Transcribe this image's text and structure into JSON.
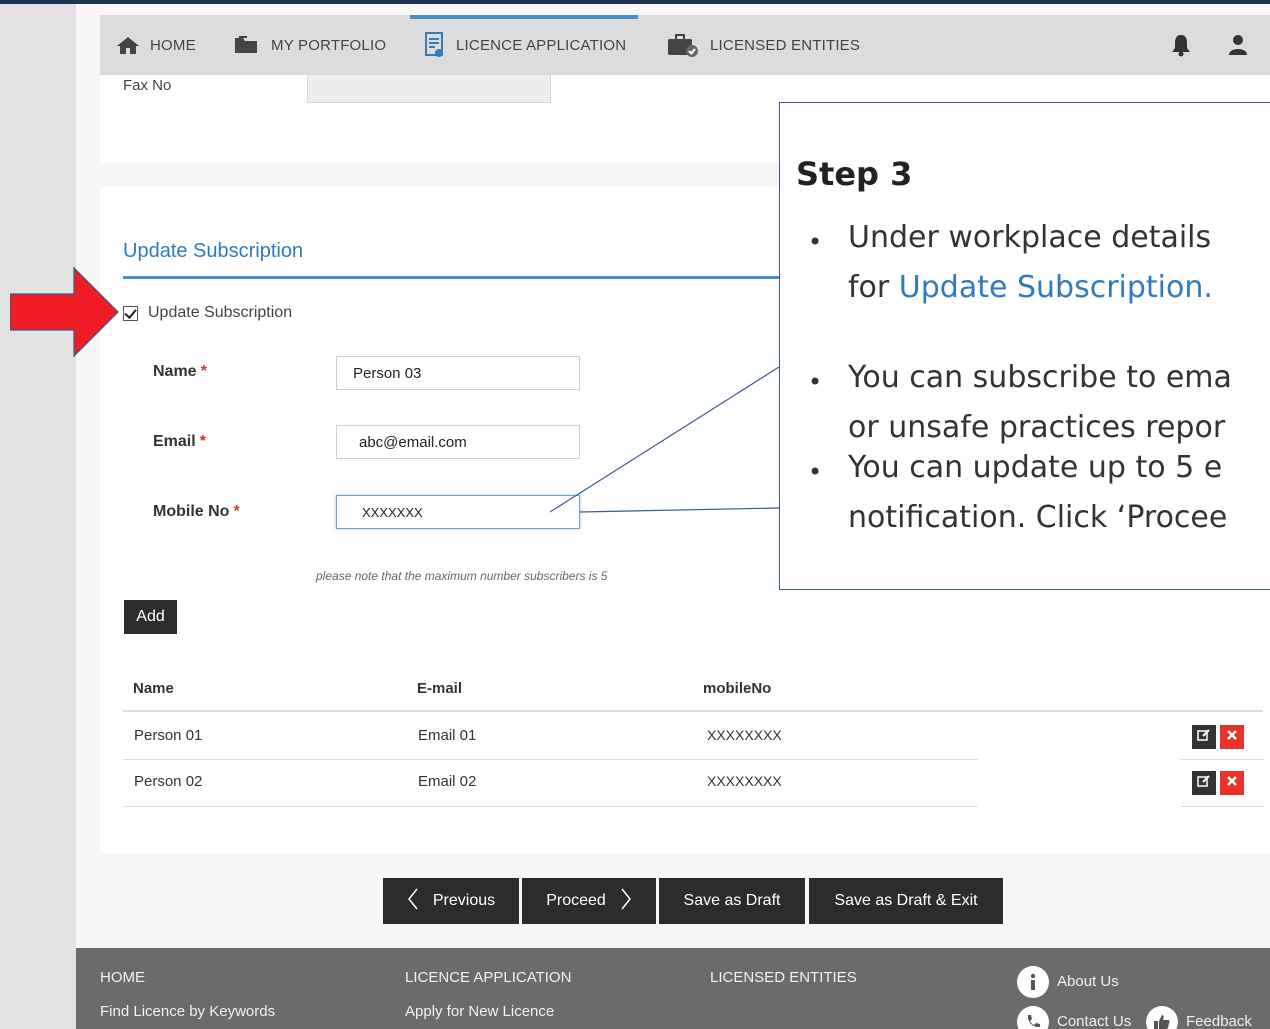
{
  "nav": {
    "home": "HOME",
    "portfolio": "MY PORTFOLIO",
    "licence_application": "LICENCE APPLICATION",
    "licensed_entities": "LICENSED ENTITIES"
  },
  "form": {
    "fax_label": "Fax No",
    "fax_value": "",
    "section_title": "Update Subscription",
    "checkbox_label": "Update Subscription",
    "checkbox_checked": true,
    "name_label": "Name",
    "name_value": "Person 03",
    "email_label": "Email",
    "email_value": "abc@email.com",
    "mobile_label": "Mobile No",
    "mobile_value": "XXXXXXX",
    "required_mark": "*",
    "note": "please note that the maximum number subscribers is 5",
    "add_label": "Add"
  },
  "table": {
    "headers": [
      "Name",
      "E-mail",
      "mobileNo"
    ],
    "rows": [
      {
        "name": "Person 01",
        "email": "Email 01",
        "mobile": "XXXXXXXX"
      },
      {
        "name": "Person 02",
        "email": "Email 02",
        "mobile": "XXXXXXXX"
      }
    ]
  },
  "buttons": {
    "previous": "Previous",
    "proceed": "Proceed",
    "save_draft": "Save as Draft",
    "save_draft_exit": "Save as Draft & Exit"
  },
  "footer": {
    "home": "HOME",
    "find_licence": "Find Licence by Keywords",
    "licence_application": "LICENCE APPLICATION",
    "apply_new": "Apply for New Licence",
    "licensed_entities": "LICENSED ENTITIES",
    "about_us": "About Us",
    "contact_us": "Contact Us",
    "feedback": "Feedback"
  },
  "callout": {
    "title": "Step 3",
    "bullet1_line1": "Under workplace details",
    "bullet1_line2_prefix": "for ",
    "bullet1_line2_link": "Update Subscription.",
    "bullet2_line1": "You can subscribe to ema",
    "bullet2_line2": "or unsafe practices repor",
    "bullet3_line1": "You can update up to 5 e",
    "bullet3_line2": "notification. Click ‘Procee",
    "bullet_glyph": "•"
  },
  "colors": {
    "accent": "#4a8fc4",
    "link": "#2f7bbf",
    "danger": "#e8312a",
    "arrow": "#ee1c24"
  }
}
